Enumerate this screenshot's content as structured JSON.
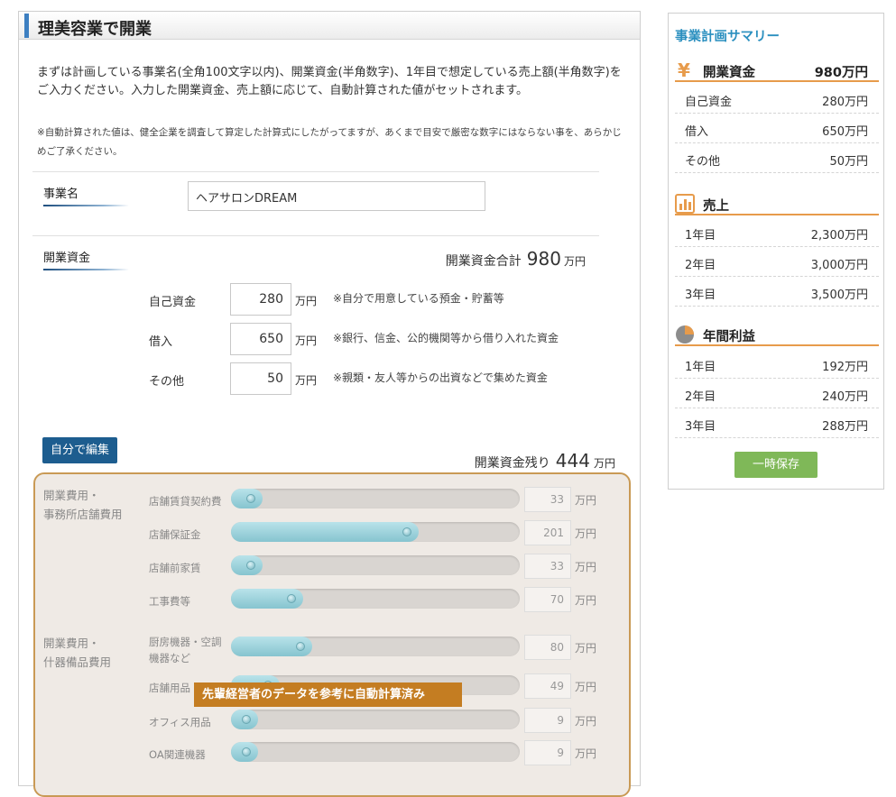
{
  "main": {
    "title": "理美容業で開業",
    "intro": "まずは計画している事業名(全角100文字以内)、開業資金(半角数字)、1年目で想定している売上額(半角数字)をご入力ください。入力した開業資金、売上額に応じて、自動計算された値がセットされます。",
    "note": "※自動計算された値は、健全企業を調査して算定した計算式にしたがってますが、あくまで目安で厳密な数字にはならない事を、あらかじめご了承ください。",
    "business_name_label": "事業名",
    "business_name_value": "ヘアサロンDREAM",
    "funds_label": "開業資金",
    "total_label": "開業資金合計",
    "total_value": "980",
    "unit": "万円",
    "fund_rows": [
      {
        "label": "自己資金",
        "value": "280",
        "unit": "万円",
        "desc": "※自分で用意している預金・貯蓄等"
      },
      {
        "label": "借入",
        "value": "650",
        "unit": "万円",
        "desc": "※銀行、信金、公的機関等から借り入れた資金"
      },
      {
        "label": "その他",
        "value": "50",
        "unit": "万円",
        "desc": "※親類・友人等からの出資などで集めた資金"
      }
    ],
    "edit_button": "自分で編集",
    "remain_label": "開業資金残り",
    "remain_value": "444",
    "groups": [
      {
        "label_line1": "開業費用・",
        "label_line2": "事務所店舗費用"
      },
      {
        "label_line1": "開業費用・",
        "label_line2": "什器備品費用"
      }
    ],
    "sliders": [
      {
        "label": "店舗賃貸契約費",
        "value": "33",
        "level": 0.06
      },
      {
        "label": "店舗保証金",
        "value": "201",
        "level": 0.6
      },
      {
        "label": "店舗前家賃",
        "value": "33",
        "level": 0.06
      },
      {
        "label": "工事費等",
        "value": "70",
        "level": 0.2
      },
      {
        "label": "厨房機器・空調機器など",
        "value": "80",
        "level": 0.23
      },
      {
        "label": "店舗用品",
        "value": "49",
        "level": 0.12
      },
      {
        "label": "オフィス用品",
        "value": "9",
        "level": 0.02
      },
      {
        "label": "OA関連機器",
        "value": "9",
        "level": 0.02
      }
    ],
    "tooltip": "先輩経営者のデータを参考に自動計算済み"
  },
  "sidebar": {
    "title": "事業計画サマリー",
    "funds": {
      "heading": "開業資金",
      "value": "980万円",
      "rows": [
        {
          "k": "自己資金",
          "v": "280万円"
        },
        {
          "k": "借入",
          "v": "650万円"
        },
        {
          "k": "その他",
          "v": "50万円"
        }
      ]
    },
    "sales": {
      "heading": "売上",
      "rows": [
        {
          "k": "1年目",
          "v": "2,300万円"
        },
        {
          "k": "2年目",
          "v": "3,000万円"
        },
        {
          "k": "3年目",
          "v": "3,500万円"
        }
      ]
    },
    "profit": {
      "heading": "年間利益",
      "rows": [
        {
          "k": "1年目",
          "v": "192万円"
        },
        {
          "k": "2年目",
          "v": "240万円"
        },
        {
          "k": "3年目",
          "v": "288万円"
        }
      ]
    },
    "save_button": "一時保存"
  },
  "colors": {
    "accent": "#3d7fc1",
    "summary_title": "#2a8fbf",
    "rule": "#e79b4b",
    "save": "#7fb858",
    "tooltip": "#c47d22",
    "slider_border": "#c99a55"
  },
  "icons": {
    "funds": "yen-icon",
    "sales": "bar-chart-icon",
    "profit": "pie-chart-icon"
  }
}
